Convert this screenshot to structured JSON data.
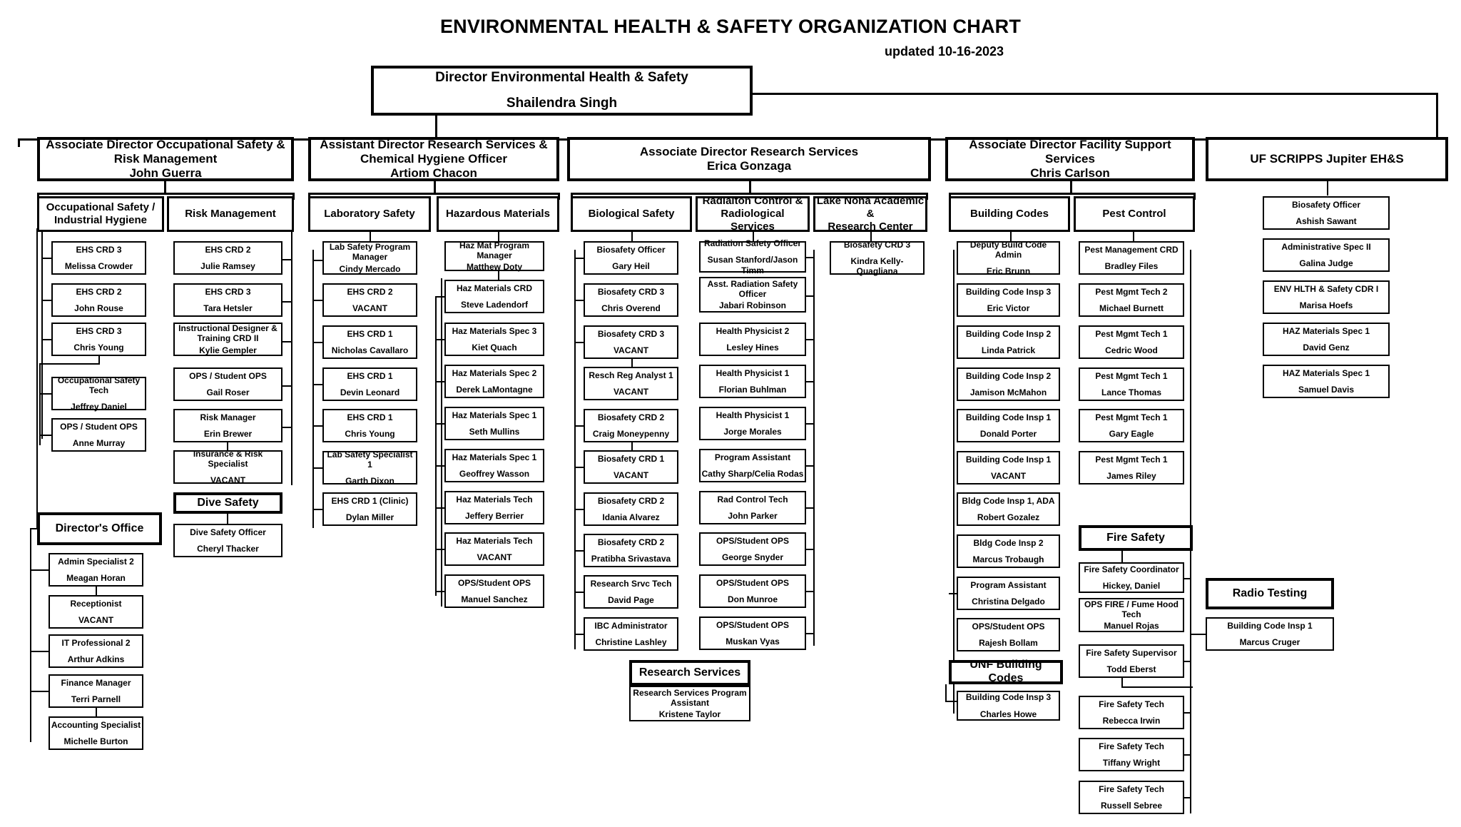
{
  "header": {
    "title": "ENVIRONMENTAL HEALTH & SAFETY ORGANIZATION CHART",
    "updated": "updated 10-16-2023"
  },
  "director": {
    "title": "Director Environmental Health & Safety",
    "name": "Shailendra Singh"
  },
  "divisions": [
    {
      "title_line1": "Associate Director Occupational Safety &",
      "title_line2": "Risk Management",
      "name": "John Guerra"
    },
    {
      "title_line1": "Assistant Director Research Services &",
      "title_line2": "Chemical Hygiene Officer",
      "name": "Artiom Chacon"
    },
    {
      "title_line1": "Associate Director Research Services",
      "title_line2": "",
      "name": "Erica Gonzaga"
    },
    {
      "title_line1": "Associate Director Facility Support Services",
      "title_line2": "",
      "name": "Chris Carlson"
    },
    {
      "title_line1": "UF SCRIPPS Jupiter EH&S",
      "title_line2": "",
      "name": ""
    }
  ],
  "groups": {
    "occupational_safety": "Occupational Safety / Industrial Hygiene",
    "risk_management": "Risk Management",
    "laboratory_safety": "Laboratory Safety",
    "hazardous_materials": "Hazardous Materials",
    "biological_safety": "Biological Safety",
    "radiation_control": "Radiaiton Control & Radiological Services",
    "lake_nona": "Lake Nona Academic & Research Center",
    "building_codes": "Building Codes",
    "pest_control": "Pest Control",
    "directors_office": "Director's Office",
    "dive_safety": "Dive Safety",
    "research_services": "Research Services",
    "fire_safety": "Fire Safety",
    "unf_building_codes": "UNF Building Codes",
    "radio_testing": "Radio Testing"
  },
  "occupational_safety_staff": [
    {
      "role": "EHS CRD 3",
      "name": "Melissa Crowder"
    },
    {
      "role": "EHS CRD 2",
      "name": "John Rouse"
    },
    {
      "role": "EHS CRD 3",
      "name": "Chris Young"
    },
    {
      "role": "Occupational Safety Tech",
      "name": "Jeffrey Daniel"
    },
    {
      "role": "OPS / Student OPS",
      "name": "Anne Murray"
    }
  ],
  "risk_management_staff": [
    {
      "role": "EHS CRD 2",
      "name": "Julie Ramsey"
    },
    {
      "role": "EHS CRD 3",
      "name": "Tara Hetsler"
    },
    {
      "role": "Instructional Designer & Training CRD II",
      "name": "Kylie Gempler",
      "threeline": true
    },
    {
      "role": "OPS / Student OPS",
      "name": "Gail Roser"
    },
    {
      "role": "Risk Manager",
      "name": "Erin Brewer"
    },
    {
      "role": "Insurance & Risk Specialist",
      "name": "VACANT"
    }
  ],
  "dive_safety_staff": [
    {
      "role": "Dive Safety Officer",
      "name": "Cheryl Thacker"
    }
  ],
  "directors_office_staff": [
    {
      "role": "Admin Specialist 2",
      "name": "Meagan Horan"
    },
    {
      "role": "Receptionist",
      "name": "VACANT"
    },
    {
      "role": "IT Professional 2",
      "name": "Arthur Adkins"
    },
    {
      "role": "Finance Manager",
      "name": "Terri Parnell"
    },
    {
      "role": "Accounting Specialist",
      "name": "Michelle Burton"
    }
  ],
  "laboratory_safety_staff": [
    {
      "role": "Lab Safety Program Manager",
      "name": "Cindy Mercado",
      "threeline": true
    },
    {
      "role": "EHS CRD 2",
      "name": "VACANT"
    },
    {
      "role": "EHS CRD 1",
      "name": "Nicholas Cavallaro"
    },
    {
      "role": "EHS CRD 1",
      "name": "Devin Leonard"
    },
    {
      "role": "EHS CRD 1",
      "name": "Chris Young"
    },
    {
      "role": "Lab Safety Specialist 1",
      "name": "Garth Dixon"
    },
    {
      "role": "EHS CRD 1 (Clinic)",
      "name": "Dylan Miller"
    }
  ],
  "hazardous_materials_staff": [
    {
      "role": "Haz Mat Program Manager",
      "name": "Matthew Doty"
    },
    {
      "role": "Haz Materials CRD",
      "name": "Steve Ladendorf"
    },
    {
      "role": "Haz Materials Spec 3",
      "name": "Kiet Quach"
    },
    {
      "role": "Haz Materials Spec 2",
      "name": "Derek LaMontagne"
    },
    {
      "role": "Haz Materials Spec 1",
      "name": "Seth Mullins"
    },
    {
      "role": "Haz Materials Spec 1",
      "name": "Geoffrey Wasson"
    },
    {
      "role": "Haz Materials Tech",
      "name": "Jeffery Berrier"
    },
    {
      "role": "Haz Materials Tech",
      "name": "VACANT"
    },
    {
      "role": "OPS/Student OPS",
      "name": "Manuel Sanchez"
    }
  ],
  "biological_safety_staff": [
    {
      "role": "Biosafety Officer",
      "name": "Gary Heil"
    },
    {
      "role": "Biosafety CRD 3",
      "name": "Chris Overend"
    },
    {
      "role": "Biosafety CRD 3",
      "name": "VACANT"
    },
    {
      "role": "Resch Reg Analyst 1",
      "name": "VACANT"
    },
    {
      "role": "Biosafety CRD 2",
      "name": "Craig Moneypenny"
    },
    {
      "role": "Biosafety CRD 1",
      "name": "VACANT"
    },
    {
      "role": "Biosafety CRD 2",
      "name": "Idania Alvarez"
    },
    {
      "role": "Biosafety CRD 2",
      "name": "Pratibha Srivastava"
    },
    {
      "role": "Research Srvc Tech",
      "name": "David Page"
    },
    {
      "role": "IBC Administrator",
      "name": "Christine Lashley"
    }
  ],
  "radiation_control_staff": [
    {
      "role": "Radiation Safety Officer",
      "name": "Susan Stanford/Jason Timm"
    },
    {
      "role": "Asst. Radiation Safety Officer",
      "name": "Jabari Robinson",
      "threeline": true
    },
    {
      "role": "Health Physicist 2",
      "name": "Lesley Hines"
    },
    {
      "role": "Health Physicist 1",
      "name": "Florian Buhlman"
    },
    {
      "role": "Health Physicist 1",
      "name": "Jorge Morales"
    },
    {
      "role": "Program Assistant",
      "name": "Cathy Sharp/Celia Rodas"
    },
    {
      "role": "Rad Control Tech",
      "name": "John Parker"
    },
    {
      "role": "OPS/Student OPS",
      "name": "George Snyder"
    },
    {
      "role": "OPS/Student OPS",
      "name": "Don Munroe"
    },
    {
      "role": "OPS/Student OPS",
      "name": "Muskan Vyas"
    }
  ],
  "lake_nona_staff": [
    {
      "role": "Biosafety CRD 3",
      "name": "Kindra Kelly-Quagliana"
    }
  ],
  "research_services_staff": [
    {
      "role": "Research Services Program Assistant",
      "name": "Kristene Taylor",
      "threeline": true
    }
  ],
  "building_codes_staff": [
    {
      "role": "Deputy Build Code Admin",
      "name": "Eric Brunn"
    },
    {
      "role": "Building Code Insp 3",
      "name": "Eric Victor"
    },
    {
      "role": "Building Code Insp 2",
      "name": "Linda Patrick"
    },
    {
      "role": "Building Code Insp 2",
      "name": "Jamison McMahon"
    },
    {
      "role": "Building Code Insp 1",
      "name": "Donald Porter"
    },
    {
      "role": "Building Code Insp 1",
      "name": "VACANT"
    },
    {
      "role": "Bldg Code Insp 1, ADA",
      "name": "Robert Gozalez"
    },
    {
      "role": "Bldg Code Insp 2",
      "name": "Marcus Trobaugh"
    },
    {
      "role": "Program Assistant",
      "name": "Christina Delgado"
    },
    {
      "role": "OPS/Student OPS",
      "name": "Rajesh Bollam"
    }
  ],
  "unf_building_codes_staff": [
    {
      "role": "Building Code Insp 3",
      "name": "Charles Howe"
    }
  ],
  "pest_control_staff": [
    {
      "role": "Pest Management CRD",
      "name": "Bradley Files"
    },
    {
      "role": "Pest Mgmt Tech 2",
      "name": "Michael Burnett"
    },
    {
      "role": "Pest Mgmt Tech 1",
      "name": "Cedric Wood"
    },
    {
      "role": "Pest Mgmt Tech 1",
      "name": "Lance Thomas"
    },
    {
      "role": "Pest Mgmt Tech 1",
      "name": "Gary Eagle"
    },
    {
      "role": "Pest Mgmt Tech 1",
      "name": "James Riley"
    }
  ],
  "fire_safety_staff": [
    {
      "role": "Fire Safety Coordinator",
      "name": "Hickey, Daniel"
    },
    {
      "role": "OPS FIRE / Fume Hood Tech",
      "name": "Manuel Rojas",
      "threeline": true
    },
    {
      "role": "Fire Safety Supervisor",
      "name": "Todd Eberst"
    },
    {
      "role": "Fire Safety Tech",
      "name": "Rebecca Irwin"
    },
    {
      "role": "Fire Safety Tech",
      "name": "Tiffany Wright"
    },
    {
      "role": "Fire Safety Tech",
      "name": "Russell Sebree"
    }
  ],
  "radio_testing_staff": [
    {
      "role": "Building Code Insp 1",
      "name": "Marcus Cruger"
    }
  ],
  "scripps_staff": [
    {
      "role": "Biosafety Officer",
      "name": "Ashish Sawant"
    },
    {
      "role": "Administrative Spec II",
      "name": "Galina Judge"
    },
    {
      "role": "ENV HLTH & Safety CDR I",
      "name": "Marisa Hoefs"
    },
    {
      "role": "HAZ Materials Spec 1",
      "name": "David Genz"
    },
    {
      "role": "HAZ Materials Spec 1",
      "name": "Samuel Davis"
    }
  ]
}
